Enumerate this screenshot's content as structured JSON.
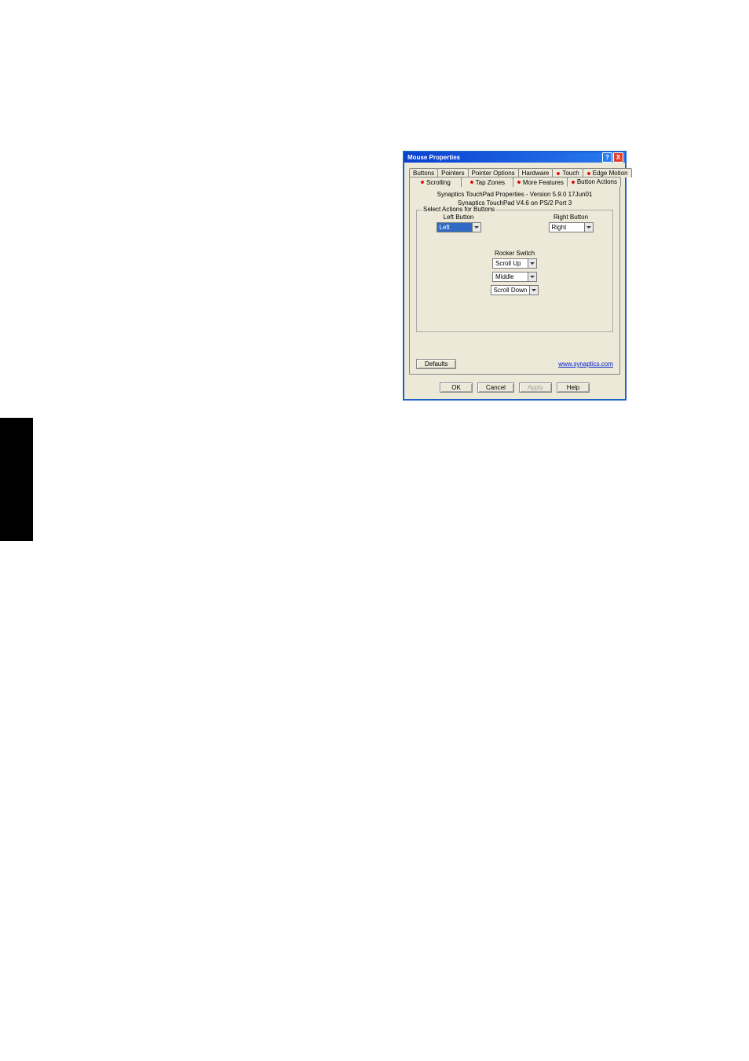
{
  "window": {
    "title": "Mouse Properties",
    "help_symbol": "?",
    "close_symbol": "X"
  },
  "tabs_row1": {
    "buttons": "Buttons",
    "pointers": "Pointers",
    "pointer_options": "Pointer Options",
    "hardware": "Hardware",
    "touch": "Touch",
    "edge_motion": "Edge Motion"
  },
  "tabs_row2": {
    "scrolling": "Scrolling",
    "tap_zones": "Tap Zones",
    "more_features": "More Features",
    "button_actions": "Button Actions"
  },
  "header": {
    "line1": "Synaptics TouchPad Properties - Version 5.9.0 17Jun01",
    "line2": "Synaptics TouchPad V4.6 on PS/2 Port 3"
  },
  "fieldset": {
    "legend": "Select Actions for Buttons"
  },
  "left_button": {
    "label": "Left Button",
    "value": "Left"
  },
  "right_button": {
    "label": "Right Button",
    "value": "Right"
  },
  "rocker": {
    "title": "Rocker Switch",
    "top": "Scroll Up",
    "mid": "Middle",
    "bot": "Scroll Down"
  },
  "defaults_btn": "Defaults",
  "link": "www.synaptics.com",
  "buttons": {
    "ok": "OK",
    "cancel": "Cancel",
    "apply": "Apply",
    "help": "Help"
  }
}
